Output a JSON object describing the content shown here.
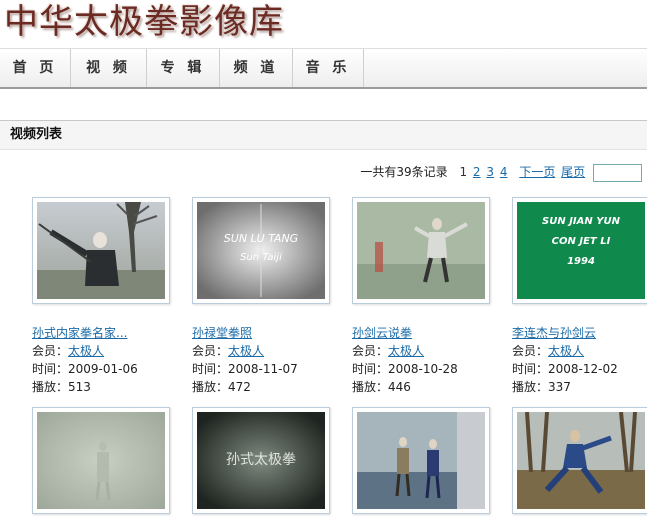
{
  "site": {
    "title": "中华太极拳影像库"
  },
  "nav": {
    "items": [
      "首 页",
      "视 频",
      "专 辑",
      "频 道",
      "音 乐"
    ]
  },
  "panel": {
    "title": "视频列表"
  },
  "pager": {
    "summary": "一共有39条记录",
    "current": "1",
    "pages": [
      "2",
      "3",
      "4"
    ],
    "next": "下一页",
    "last": "尾页",
    "input_value": ""
  },
  "labels": {
    "member": "会员：",
    "time": "时间：",
    "plays": "播放："
  },
  "videos": [
    {
      "title": "孙式内家拳名家...",
      "member": "太极人",
      "time": "2009-01-06",
      "plays": "513"
    },
    {
      "title": "孙禄堂拳照",
      "member": "太极人",
      "time": "2008-11-07",
      "plays": "472",
      "thumb_text": [
        "SUN LU TANG",
        "Sun Taiji"
      ]
    },
    {
      "title": "孙剑云说拳",
      "member": "太极人",
      "time": "2008-10-28",
      "plays": "446"
    },
    {
      "title": "李连杰与孙剑云",
      "member": "太极人",
      "time": "2008-12-02",
      "plays": "337",
      "thumb_text": [
        "SUN JIAN YUN",
        "CON JET LI",
        "1994"
      ]
    },
    {
      "title": "",
      "member": "",
      "time": "",
      "plays": ""
    },
    {
      "title": "",
      "member": "",
      "time": "",
      "plays": "",
      "thumb_text": [
        "孙式太极拳"
      ]
    },
    {
      "title": "",
      "member": "",
      "time": "",
      "plays": ""
    },
    {
      "title": "",
      "member": "",
      "time": "",
      "plays": ""
    }
  ]
}
